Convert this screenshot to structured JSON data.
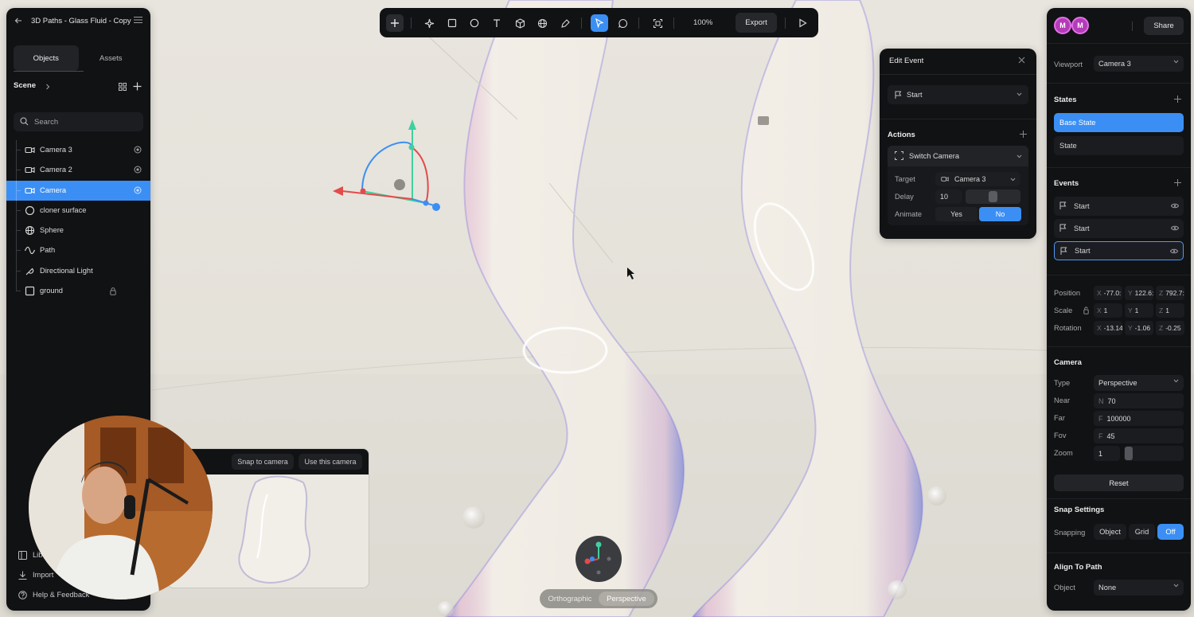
{
  "file": {
    "title": "3D Paths - Glass Fluid - Copy"
  },
  "left_panel": {
    "tabs": [
      "Objects",
      "Assets"
    ],
    "scene_label": "Scene",
    "search_placeholder": "Search",
    "objects": [
      {
        "label": "Camera 3",
        "icon": "camera-icon",
        "right": "target-icon",
        "selected": false
      },
      {
        "label": "Camera 2",
        "icon": "camera-icon",
        "right": "target-icon",
        "selected": false
      },
      {
        "label": "Camera",
        "icon": "camera-icon",
        "right": "target-icon",
        "selected": true
      },
      {
        "label": "cloner surface",
        "icon": "circle-icon",
        "right": "",
        "selected": false
      },
      {
        "label": "Sphere",
        "icon": "sphere-icon",
        "right": "",
        "selected": false
      },
      {
        "label": "Path",
        "icon": "path-icon",
        "right": "",
        "selected": false
      },
      {
        "label": "Directional Light",
        "icon": "light-icon",
        "right": "",
        "selected": false
      },
      {
        "label": "ground",
        "icon": "square-icon",
        "right": "lock-icon",
        "selected": false
      }
    ],
    "footer": {
      "library": "Lib",
      "import": "Import",
      "help": "Help & Feedback"
    }
  },
  "toolbar": {
    "zoom": "100%",
    "export_label": "Export"
  },
  "event_panel": {
    "title": "Edit Event",
    "event_select": "Start",
    "actions_heading": "Actions",
    "action_name": "Switch Camera",
    "target_label": "Target",
    "target_value": "Camera 3",
    "delay_label": "Delay",
    "delay_value": "10",
    "animate_label": "Animate",
    "animate_yes": "Yes",
    "animate_no": "No",
    "animate_selected": "No"
  },
  "right_panel": {
    "avatars": [
      "M",
      "M"
    ],
    "share_label": "Share",
    "viewport_label": "Viewport",
    "viewport_value": "Camera 3",
    "states_heading": "States",
    "states": [
      {
        "label": "Base State",
        "active": true
      },
      {
        "label": "State",
        "active": false
      }
    ],
    "events_heading": "Events",
    "events": [
      {
        "label": "Start",
        "selected": false
      },
      {
        "label": "Start",
        "selected": false
      },
      {
        "label": "Start",
        "selected": true
      }
    ],
    "transform": {
      "position_label": "Position",
      "position": {
        "x": "-77.0:",
        "y": "122.6:",
        "z": "792.7:"
      },
      "scale_label": "Scale",
      "scale": {
        "x": "1",
        "y": "1",
        "z": "1"
      },
      "rotation_label": "Rotation",
      "rotation": {
        "x": "-13.14",
        "y": "-1.06",
        "z": "-0.25"
      }
    },
    "camera": {
      "heading": "Camera",
      "type_label": "Type",
      "type_value": "Perspective",
      "near_label": "Near",
      "near_prefix": "N",
      "near_value": "70",
      "far_label": "Far",
      "far_prefix": "F",
      "far_value": "100000",
      "fov_label": "Fov",
      "fov_prefix": "F",
      "fov_value": "45",
      "zoom_label": "Zoom",
      "zoom_value": "1",
      "reset_label": "Reset"
    },
    "snap": {
      "heading": "Snap Settings",
      "snapping_label": "Snapping",
      "options": [
        "Object",
        "Grid",
        "Off"
      ],
      "selected": "Off"
    },
    "align": {
      "heading": "Align To Path",
      "object_label": "Object",
      "object_value": "None"
    }
  },
  "camera_preview": {
    "snap_label": "Snap to camera",
    "use_label": "Use this camera"
  },
  "view_switch": {
    "options": [
      "Orthographic",
      "Perspective"
    ],
    "selected": "Perspective"
  },
  "colors": {
    "accent": "#3b8ff4",
    "panel": "#111214",
    "avatar": "#b33bb8"
  }
}
